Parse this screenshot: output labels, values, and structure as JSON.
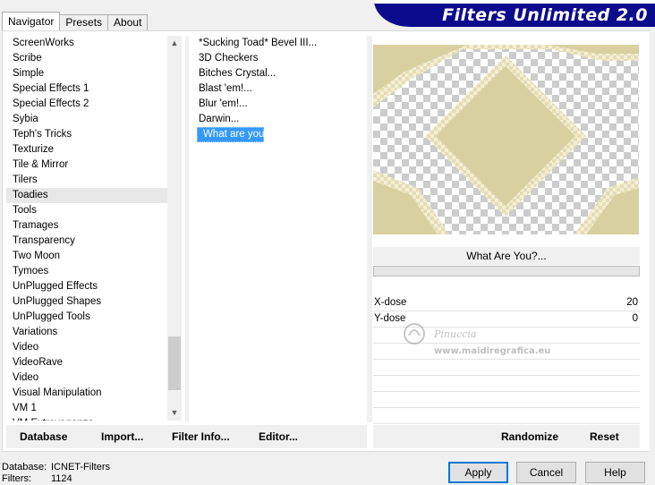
{
  "tabs": [
    {
      "label": "Navigator",
      "active": true
    },
    {
      "label": "Presets",
      "active": false
    },
    {
      "label": "About",
      "active": false
    }
  ],
  "banner": {
    "title": "Filters Unlimited 2.0"
  },
  "categories": [
    "ScreenWorks",
    "Scribe",
    "Simple",
    "Special Effects 1",
    "Special Effects 2",
    "Sybia",
    "Teph's Tricks",
    "Texturize",
    "Tile & Mirror",
    "Tilers",
    "Toadies",
    "Tools",
    "Tramages",
    "Transparency",
    "Two Moon",
    "Tymoes",
    "UnPlugged Effects",
    "UnPlugged Shapes",
    "UnPlugged Tools",
    "Variations",
    "Video",
    "VideoRave",
    "Video",
    "Visual Manipulation",
    "VM 1",
    "VM Extravaganza"
  ],
  "selected_category": "Toadies",
  "filters": [
    "*Sucking Toad*  Bevel III...",
    "3D Checkers",
    "Bitches Crystal...",
    "Blast 'em!...",
    "Blur 'em!...",
    "Darwin...",
    "What are you?"
  ],
  "selected_filter": "What are you?",
  "filter_name": "What Are You?...",
  "params": [
    {
      "name": "X-dose",
      "value": "20"
    },
    {
      "name": "Y-dose",
      "value": "0"
    }
  ],
  "watermark": {
    "line1": "Pinuccia",
    "line2": "www.maidiregrafica.eu"
  },
  "left_toolbar": {
    "database": "Database",
    "import": "Import...",
    "filter_info": "Filter Info...",
    "editor": "Editor..."
  },
  "right_toolbar": {
    "randomize": "Randomize",
    "reset": "Reset"
  },
  "status": {
    "database_label": "Database:",
    "database_value": "ICNET-Filters",
    "filters_label": "Filters:",
    "filters_value": "1124"
  },
  "dialog": {
    "apply": "Apply",
    "cancel": "Cancel",
    "help": "Help"
  },
  "colors": {
    "banner": "#0b0b8e",
    "selection": "#3399ff",
    "preview_fill": "#d8d0a0"
  }
}
